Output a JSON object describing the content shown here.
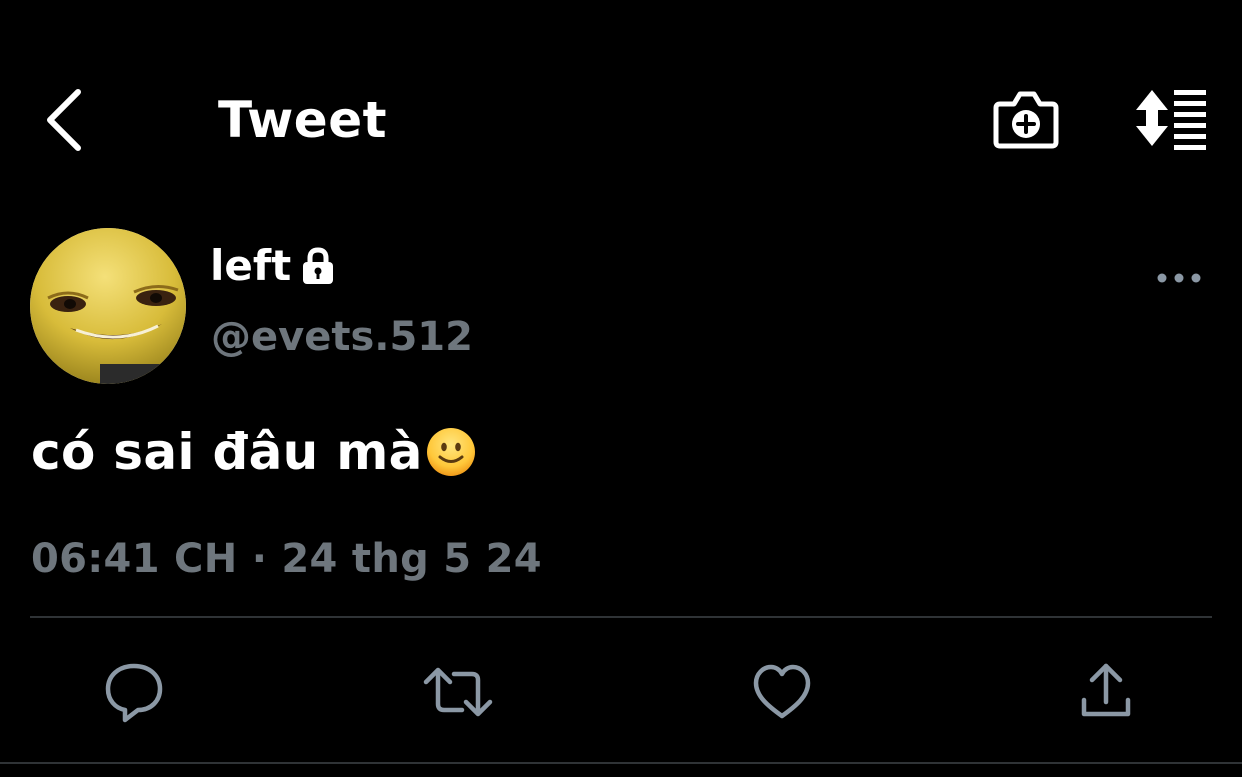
{
  "header": {
    "title": "Tweet",
    "back_icon": "chevron-left-icon",
    "camera_icon": "camera-plus-icon",
    "sort_icon": "sort-list-icon"
  },
  "author": {
    "display_name": "left",
    "handle": "@evets.512",
    "protected_icon": "lock-icon",
    "avatar": "avatar-image"
  },
  "tweet": {
    "text": "có sai đâu mà",
    "emoji": "slightly-smiling-face-emoji",
    "timestamp": "06:41 CH · 24 thg 5 24"
  },
  "actions": {
    "reply_icon": "reply-icon",
    "retweet_icon": "retweet-icon",
    "like_icon": "heart-icon",
    "share_icon": "share-icon",
    "more_icon": "more-icon"
  },
  "colors": {
    "background": "#000000",
    "text_primary": "#ffffff",
    "text_secondary": "#6e767d",
    "divider": "#2f3336",
    "icon_secondary": "#8b98a5"
  }
}
